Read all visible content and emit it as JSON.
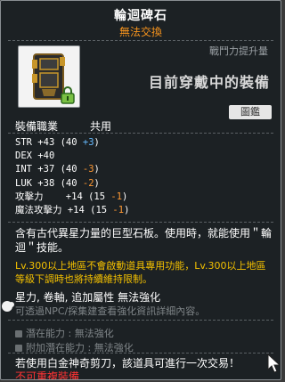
{
  "item": {
    "name": "輪迴碑石",
    "trade_status": "無法交換",
    "icon": "stone-tablet-icon",
    "lock_icon": "lock-icon"
  },
  "combat_power": {
    "label": "戰鬥力提升量",
    "value": "目前穿戴中的裝備"
  },
  "preview_button": "圖鑑",
  "job": {
    "label": "裝備職業",
    "value": "共用"
  },
  "stats": [
    {
      "label": "STR",
      "main": "+43",
      "base": "(40 ",
      "bonus": "+3",
      "bonus_color": "blue",
      "close": ")"
    },
    {
      "label": "DEX",
      "main": "+40",
      "base": "",
      "bonus": "",
      "bonus_color": "",
      "close": ""
    },
    {
      "label": "INT",
      "main": "+37",
      "base": "(40 ",
      "bonus": "-3",
      "bonus_color": "orange",
      "close": ")"
    },
    {
      "label": "LUK",
      "main": "+38",
      "base": "(40 ",
      "bonus": "-2",
      "bonus_color": "orange",
      "close": ")"
    },
    {
      "label": "攻擊力",
      "main": "+14",
      "base": "(15 ",
      "bonus": "-1",
      "bonus_color": "orange",
      "close": ")"
    },
    {
      "label": "魔法攻擊力",
      "main": "+14",
      "base": "(15 ",
      "bonus": "-1",
      "bonus_color": "orange",
      "close": ")"
    }
  ],
  "description": "含有古代異星力量的巨型石板。使用時，就能使用＂輪迴＂技能。",
  "level_note": "Lv.300以上地區不會啟動道具專用功能，Lv.300以上地區等級下調時也將持續維持限制。",
  "attributes": "星力, 卷軸, 追加屬性 無法強化",
  "hint": "可透過NPC/探集建查看強化資訊詳細內容。",
  "potential": {
    "line1_label": "潛在能力",
    "line1_value": "無法強化",
    "line2_label": "附加潛在能力",
    "line2_value": "無法強化"
  },
  "scissors_note": "若使用白金神奇剪刀，該道具可進行一次交易！",
  "non_exchangeable": "不可重複裝備",
  "colors": {
    "background": "#1c2124",
    "title": "#ffffff",
    "trade_status": "#f7941d",
    "level_note": "#f3c000",
    "warning": "#ff3333",
    "bonus_positive": "#66bbff",
    "bonus_negative": "#ff9933"
  }
}
